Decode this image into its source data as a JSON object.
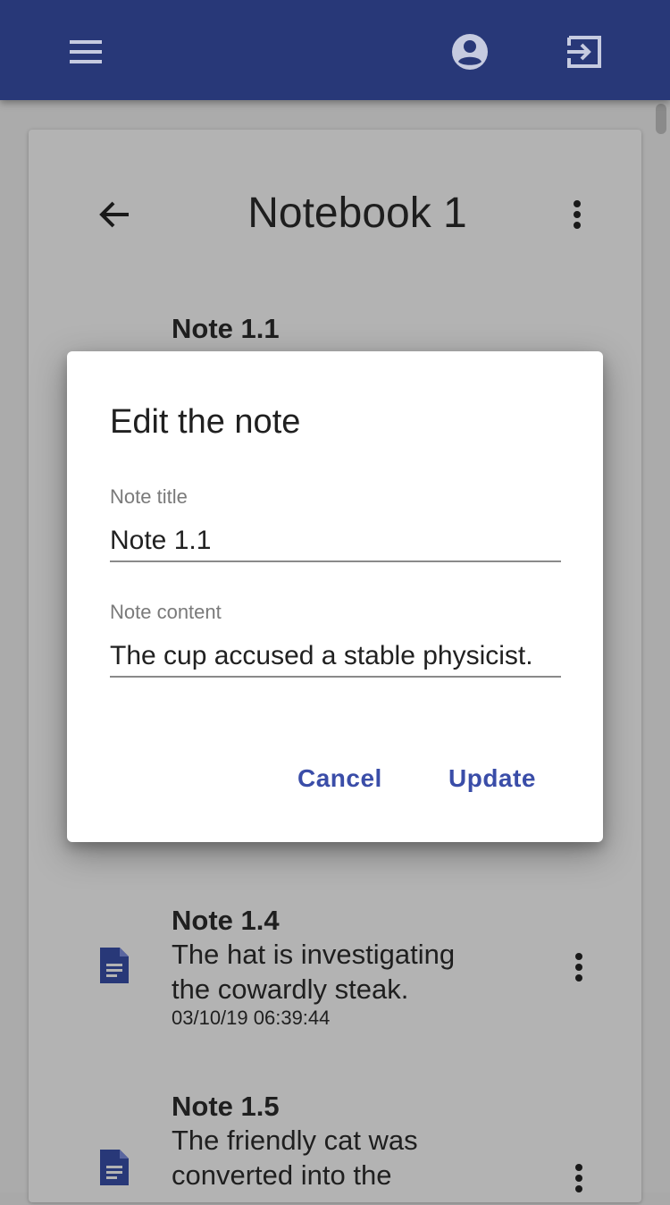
{
  "appbar": {
    "menu_icon": "menu-icon",
    "account_icon": "account-circle-icon",
    "exit_icon": "exit-to-app-icon",
    "color": "#283878"
  },
  "notebook": {
    "title": "Notebook 1",
    "back_icon": "arrow-back-icon",
    "more_icon": "more-vert-icon"
  },
  "notes": [
    {
      "title": "Note 1.1",
      "content": "The cup accused a stable physicist.",
      "icon": "document-icon"
    },
    {
      "title": "Note 1.4",
      "content": "The hat is investigating the cowardly steak.",
      "timestamp": "03/10/19 06:39:44",
      "icon": "document-icon"
    },
    {
      "title": "Note 1.5",
      "content": "The friendly cat was converted into the",
      "icon": "document-icon"
    }
  ],
  "dialog": {
    "title": "Edit the note",
    "title_field": {
      "label": "Note title",
      "value": "Note 1.1"
    },
    "content_field": {
      "label": "Note content",
      "value": "The cup accused a stable physicist."
    },
    "cancel_label": "Cancel",
    "update_label": "Update",
    "button_color": "#3a4da8"
  }
}
